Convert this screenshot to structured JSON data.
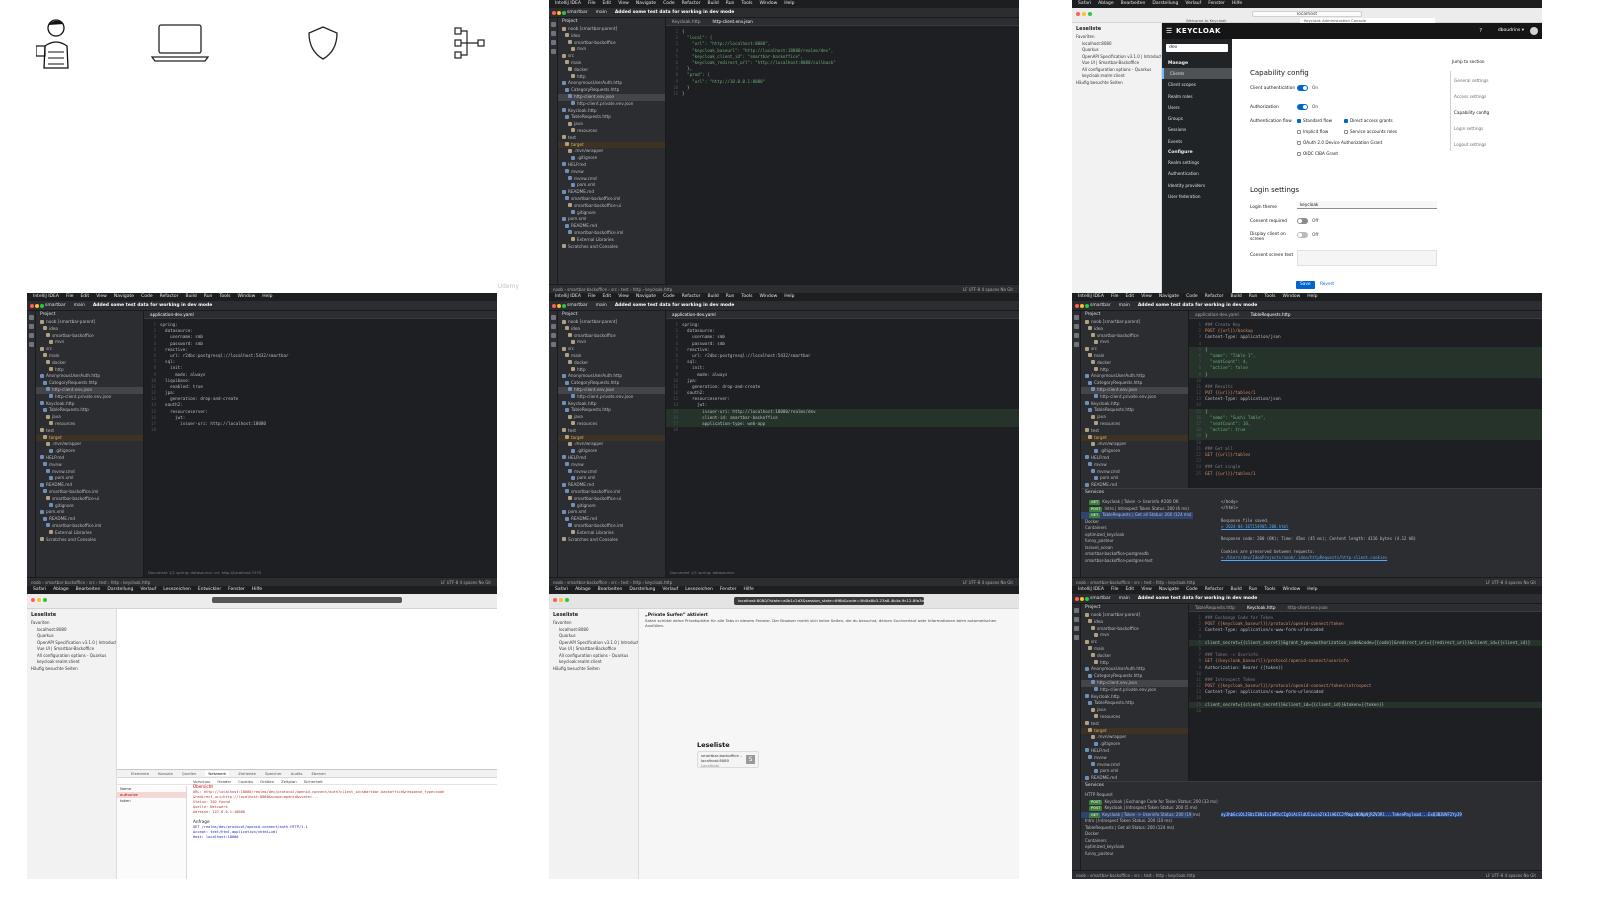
{
  "brand": "Udemy",
  "colors": {
    "ide_bg": "#1e1f22",
    "ide_panel": "#2b2d30",
    "keycloak_primary": "#0066cc",
    "keycloak_nav": "#212427"
  },
  "intro": {
    "icons": [
      "person-with-mug-icon",
      "laptop-icon",
      "shield-icon",
      "network-diagram-icon"
    ]
  },
  "ide": {
    "menu": [
      "IntelliJ IDEA",
      "File",
      "Edit",
      "View",
      "Navigate",
      "Code",
      "Refactor",
      "Build",
      "Run",
      "Tools",
      "Window",
      "Help"
    ],
    "project_widget": "smartbar",
    "branch": "main",
    "commit": "Added some test data for working in dev mode",
    "project_label": "Project",
    "status_path": "noob › smartbar-backoffice › src › test › http › keycloak.http",
    "status_right": "LF  UTF-8  4 spaces  No Git",
    "tree_a": [
      {
        "t": "noob [smartbar-parent]",
        "d": 1
      },
      {
        "t": "idea",
        "d": 1
      },
      {
        "t": "smartbar-backoffice",
        "d": 1
      },
      {
        "t": "mvn",
        "d": 1
      },
      {
        "t": "src",
        "d": 1
      },
      {
        "t": "main",
        "d": 1
      },
      {
        "t": "docker",
        "d": 1
      },
      {
        "t": "http",
        "d": 1
      },
      {
        "t": "AnonymousUserAuth.http",
        "d": 0
      },
      {
        "t": "CategoryRequests.http",
        "d": 0
      },
      {
        "t": "http-client.env.json",
        "d": 0,
        "sel": true
      },
      {
        "t": "http-client.private.env.json",
        "d": 0
      },
      {
        "t": "Keycloak.http",
        "d": 0
      },
      {
        "t": "TableRequests.http",
        "d": 0
      },
      {
        "t": "java",
        "d": 1
      },
      {
        "t": "resources",
        "d": 1
      },
      {
        "t": "test",
        "d": 1
      },
      {
        "t": "target",
        "d": 1,
        "tgt": true
      },
      {
        "t": ".mvn/wrapper",
        "d": 1
      },
      {
        "t": ".gitignore",
        "d": 0
      },
      {
        "t": "HELP.md",
        "d": 0
      },
      {
        "t": "mvnw",
        "d": 0
      },
      {
        "t": "mvnw.cmd",
        "d": 0
      },
      {
        "t": "pom.xml",
        "d": 0
      },
      {
        "t": "README.md",
        "d": 0
      },
      {
        "t": "smartbar-backoffice.iml",
        "d": 0
      },
      {
        "t": "smartbar-backoffice-ui",
        "d": 1
      },
      {
        "t": "gitignore",
        "d": 0
      },
      {
        "t": "pom.xml",
        "d": 0
      },
      {
        "t": "README.md",
        "d": 0
      },
      {
        "t": "smartbar-backoffice.iml",
        "d": 0
      },
      {
        "t": "External Libraries",
        "d": 1
      },
      {
        "t": "Scratches and Consoles",
        "d": 1
      }
    ],
    "tile2": {
      "tabs": [
        "Keycloak.http",
        "http-client.env.json"
      ],
      "lines": [
        "{",
        "  \"local\": {",
        "    \"url\": \"http://localhost:8080\",",
        "    \"keycloak_baseurl\": \"http://localhost:18080/realms/dev\",",
        "    \"keycloak_client_id\": \"smartbar-backoffice\",",
        "    \"keycloak_redirect_url\": \"http://localhost:8080/callback\"",
        "  },",
        "  \"prod\": {",
        "    \"url\": \"http://10.0.0.1:8080\"",
        "  }",
        "}"
      ]
    },
    "tile4": {
      "tabs": [
        "application-dev.yaml"
      ],
      "lines": [
        "spring:",
        "  datasource:",
        "    username: smb",
        "    password: smb",
        "  reactive:",
        "    url: r2dbc:postgresql://localhost:5432/smartbar",
        "  sql:",
        "    init:",
        "      mode: always",
        "  liquibase:",
        "    enabled: true",
        "  jpa:",
        "    generation: drop-and-create",
        "  oauth2:",
        "    resourceserver:",
        "      jwt:",
        "        issuer-uri: http://localhost:18080",
        ""
      ],
      "breadcrumb": "Document 1/1  spring:  datasource:  url:  http://localhost:7070"
    },
    "tile5": {
      "tabs": [
        "application-dev.yaml"
      ],
      "lines": [
        "spring:",
        "  datasource:",
        "    username: smb",
        "    password: smb",
        "  reactive:",
        "    url: r2dbc:postgresql://localhost:5432/smartbar",
        "  sql:",
        "    init:",
        "      mode: always",
        "  jpa:",
        "    generation: drop-and-create",
        "  oauth2:",
        "    resourceserver:",
        "      jwt:",
        "        issuer-uri: http://localhost:18080/realms/dev",
        "        client-id: smartbar-backoffice",
        "        application-type: web-app",
        ""
      ],
      "breadcrumb": "Document 1/1  spring:  datasource:"
    },
    "tile6": {
      "tabs": [
        "application-dev.yaml",
        "TableRequests.http"
      ],
      "lines": [
        "### Create Key",
        "POST {{url}}/backup",
        "Content-Type: application/json",
        "",
        "{",
        "  \"name\": \"Table 1\",",
        "  \"seatCount\": 4,",
        "  \"active\": false",
        "}",
        "",
        "### Results",
        "PUT {{url}}/tables/1",
        "Content-Type: application/json",
        "",
        "{",
        "  \"name\": \"Sushi Table\",",
        "  \"seatCount\": 10,",
        "  \"active\": true",
        "}",
        "",
        "### Get all",
        "GET {{url}}/tables",
        "",
        "### Get single",
        "GET {{url}}/tables/1"
      ],
      "services_title": "Services",
      "services": [
        {
          "badge": "GET",
          "t": "Keycloak | Token -> Userinfo  #200 OK",
          "sel": false
        },
        {
          "badge": "POST",
          "t": "Intro | Introspect Token  Status: 200 (6 ms)",
          "sel": false
        },
        {
          "badge": "GET",
          "t": "TableRequests | Get all  Status: 200 (124 ms)",
          "sel": true
        },
        {
          "badge": "",
          "t": "Docker",
          "sel": false
        },
        {
          "badge": "",
          "t": "Containers",
          "sel": false
        },
        {
          "badge": "",
          "t": "optimized_keycloak",
          "sel": false
        },
        {
          "badge": "",
          "t": "funny_pasteur",
          "sel": false
        },
        {
          "badge": "",
          "t": "laravel_ocean",
          "sel": false
        },
        {
          "badge": "",
          "t": "smartbar-backoffice-postgresdb",
          "sel": false
        },
        {
          "badge": "",
          "t": "smartbar-backoffice-postgres-test",
          "sel": false
        }
      ],
      "output": [
        "</body>",
        "</html>",
        "",
        "Response file saved.",
        "> 2024-04-16T154905.200.html",
        "",
        "Response code: 200 (OK); Time: 45ms (45 ms); Content length: 4116 bytes (4.12 kB)",
        "",
        "Cookies are preserved between requests:",
        "> /Users/dev/IdeaProjects/noob/.idea/httpRequests/http-client.cookies"
      ]
    },
    "tile9": {
      "tabs": [
        "TableRequests.http",
        "Keycloak.http",
        "http-client.env.json"
      ],
      "lines": [
        "### Exchange Code for Token",
        "POST {{keycloak_baseurl}}/protocol/openid-connect/token",
        "Content-Type: application/x-www-form-urlencoded",
        "",
        "client_secret={{client_secret}}&grant_type=authorization_code&code={{code}}&redirect_uri={{redirect_uri}}&client_id={{client_id}}",
        "",
        "### Token -> Userinfo",
        "GET {{keycloak_baseurl}}/protocol/openid-connect/userinfo",
        "Authorization: Bearer {{token}}",
        "",
        "### Introspect Token",
        "POST {{keycloak_baseurl}}/protocol/openid-connect/token/introspect",
        "Content-Type: application/x-www-form-urlencoded",
        "",
        "client_secret={{client_secret}}&client_id={{client_id}}&token={{token}}",
        ""
      ],
      "services": [
        {
          "badge": "",
          "t": "HTTP Request",
          "sel": false
        },
        {
          "badge": "POST",
          "t": "Keycloak | Exchange Code for Token  Status: 200 (33 ms)",
          "sel": false
        },
        {
          "badge": "POST",
          "t": "Keycloak | Introspect Token  Status: 200 (5 ms)",
          "sel": false
        },
        {
          "badge": "GET",
          "t": "Keycloak | Token -> Userinfo  Status: 200 (19 ms)",
          "sel": true
        },
        {
          "badge": "",
          "t": "Intro | Introspect Token  Status: 200 (10 ms)",
          "sel": false
        },
        {
          "badge": "",
          "t": "TableRequests | Get all  Status: 200 (124 ms)",
          "sel": false
        },
        {
          "badge": "",
          "t": "Docker",
          "sel": false
        },
        {
          "badge": "",
          "t": "Containers",
          "sel": false
        },
        {
          "badge": "",
          "t": "optimized_keycloak",
          "sel": false
        },
        {
          "badge": "",
          "t": "funny_pasteur",
          "sel": false
        }
      ],
      "selected_output": "eyJhbGciOiJSUzI1NiIsInR5cCIgOiAiSldUIiwia2lkIiA6ICJfRmpLNGNpNjRZV3Rl...TokenPayload...ExQ3B3UVF2YyJ9"
    }
  },
  "keycloak": {
    "url": "localhost",
    "tabs": [
      "Welcome to Keycloak",
      "Keycloak Administration Console"
    ],
    "readlist_title": "Leseliste",
    "readlist_items": [
      {
        "t": "Favoriten",
        "grp": true
      },
      {
        "t": "localhost:8080"
      },
      {
        "t": "Quarkus"
      },
      {
        "t": "OpenAPI Specification v3.1.0 | Introduct..."
      },
      {
        "t": "Vue UI | Smartbar-Backoffice"
      },
      {
        "t": "All configuration options - Quarkus"
      },
      {
        "t": "keycloak:realm:client"
      },
      {
        "t": "Häufig besuchte Seiten",
        "grp": true
      }
    ],
    "logo": "KEYCLOAK",
    "user": "dboudrins ▾",
    "realm": "dev",
    "nav_manage": "Manage",
    "nav_items": [
      "Clients",
      "Client scopes",
      "Realm roles",
      "Users",
      "Groups",
      "Sessions",
      "Events"
    ],
    "nav_configure": "Configure",
    "nav_config_items": [
      "Realm settings",
      "Authentication",
      "Identity providers",
      "User federation"
    ],
    "capability_title": "Capability config",
    "client_auth": "Client authentication",
    "authorization": "Authorization",
    "auth_flow": "Authentication flow",
    "on": "On",
    "off": "Off",
    "flows": [
      {
        "t": "Standard flow",
        "c": true
      },
      {
        "t": "Direct access grants",
        "c": true
      },
      {
        "t": "Implicit flow",
        "c": false
      },
      {
        "t": "Service accounts roles",
        "c": false
      },
      {
        "t": "OAuth 2.0 Device Authorization Grant",
        "c": false
      },
      {
        "t": "OIDC CIBA Grant",
        "c": false
      }
    ],
    "login_title": "Login settings",
    "login_theme": "Login theme",
    "login_theme_value": "keycloak",
    "consent_required": "Consent required",
    "display_client": "Display client on screen",
    "consent_text": "Consent screen text",
    "save": "Save",
    "revert": "Revert",
    "jump_title": "Jump to section",
    "jump_items": [
      "General settings",
      "Access settings",
      "Capability config",
      "Login settings",
      "Logout settings"
    ]
  },
  "safari7": {
    "readlist_title": "Leseliste",
    "tabs": [
      "Elemente",
      "Konsole",
      "Quellen",
      "Netzwerk",
      "Zeitleiste",
      "Speicher",
      "Audits",
      "Ebenen"
    ],
    "subtabs": [
      "Vorschau",
      "Header",
      "Cookies",
      "Größen",
      "Zeitplan",
      "Sicherheit"
    ],
    "requests": [
      "Name",
      "authorize",
      "token"
    ],
    "detail_heading": "Übersicht",
    "detail_lines": [
      "URL: http://localhost:18080/realms/dev/protocol/openid-connect/auth?client_id=smartbar-backoffice&response_type=code",
      "&redirect_uri=http://localhost:8080&scope=openid&state=...",
      "Status: 302 Found",
      "Quelle: Netzwerk",
      "Adresse: 127.0.0.1:18080"
    ],
    "request_heading": "Anfrage",
    "request_lines": [
      "GET /realms/dev/protocol/openid-connect/auth HTTP/1.1",
      "Accept: text/html,application/xhtml+xml",
      "Host: localhost:18080"
    ]
  },
  "safari8": {
    "readlist_title": "Leseliste",
    "url": "localhost:8080/?state=a0b1c2d3&session_state=6f6b&code=4fd0a8b3-23a8-4b4a-9c12-8fa3d2c4e6f7.6b4e2a1c-38f5-4a7e-9d0c-f2e3a4b5c6d7",
    "notice_title": "„Private Surfen“ aktiviert",
    "notice_text": "Safari schützt deine Privatsphäre für alle Tabs in diesem Fenster. Der Browser merkt sich keine Seiten, die du besuchst, deinen Suchverlauf oder Informationen beim automatischen Ausfüllen.",
    "readlist_heading": "Leseliste",
    "card_title": "smartbar-backoffice – localhost:8080",
    "card_sub": "Localhost",
    "card_letter": "S"
  }
}
